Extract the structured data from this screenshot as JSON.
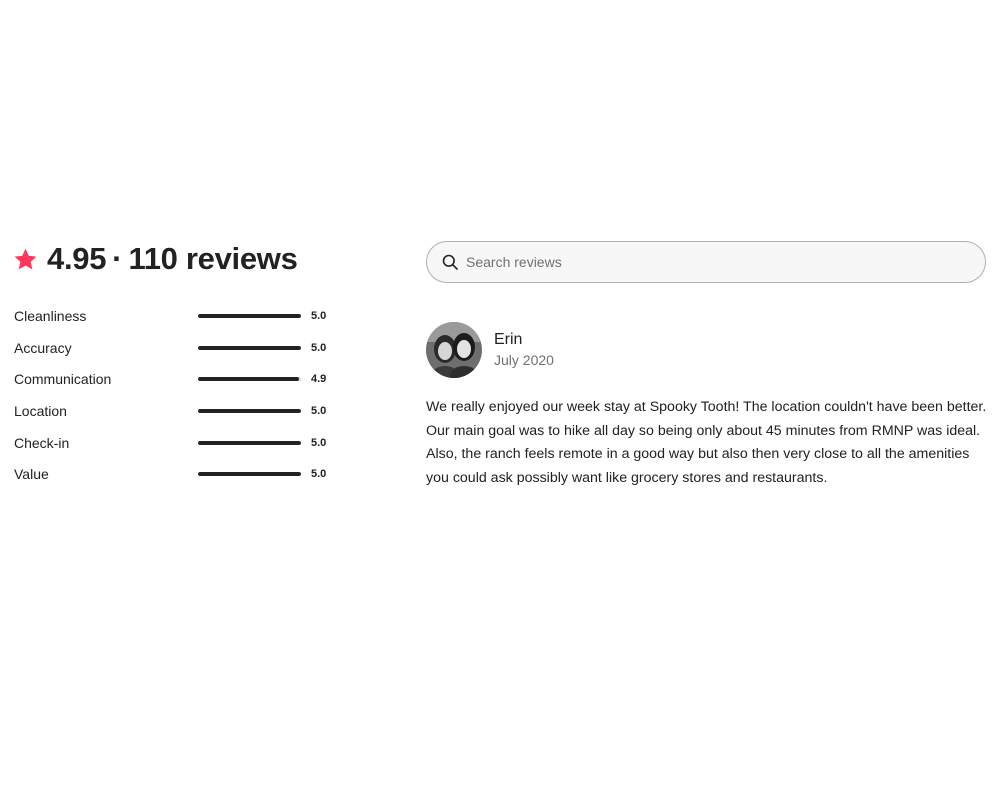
{
  "summary": {
    "star_icon": "star-icon",
    "rating": "4.95",
    "separator": "·",
    "reviews_count_label": "110 reviews",
    "accent_color": "#FF385C"
  },
  "categories": [
    {
      "label": "Cleanliness",
      "value": "5.0",
      "score": 5.0
    },
    {
      "label": "Accuracy",
      "value": "5.0",
      "score": 5.0
    },
    {
      "label": "Communication",
      "value": "4.9",
      "score": 4.9
    },
    {
      "label": "Location",
      "value": "5.0",
      "score": 5.0
    },
    {
      "label": "Check-in",
      "value": "5.0",
      "score": 5.0
    },
    {
      "label": "Value",
      "value": "5.0",
      "score": 5.0
    }
  ],
  "search": {
    "icon": "search-icon",
    "placeholder": "Search reviews",
    "value": ""
  },
  "review": {
    "reviewer_name": "Erin",
    "date": "July 2020",
    "text": "We really enjoyed our week stay at Spooky Tooth! The location couldn't have been better. Our main goal was to hike all day so being only about 45 minutes from RMNP was ideal. Also, the ranch feels remote in a good way but also then very close to all the amenities you could ask possibly want like grocery stores and restaurants."
  }
}
